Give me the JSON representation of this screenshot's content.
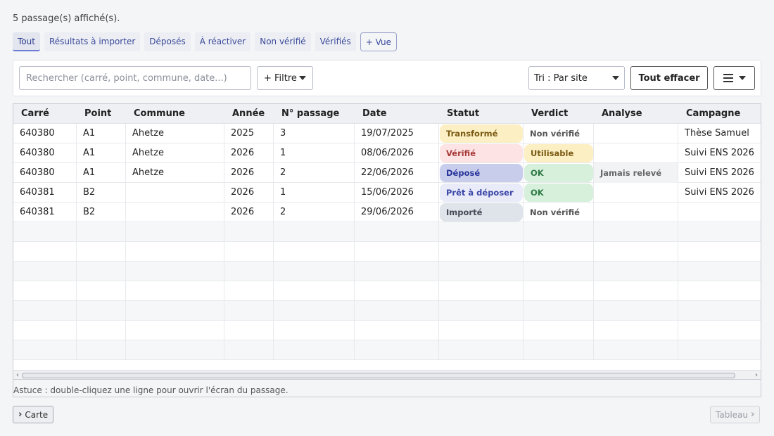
{
  "summary": "5 passage(s) affiché(s).",
  "tabs": [
    {
      "label": "Tout",
      "active": true
    },
    {
      "label": "Résultats à importer"
    },
    {
      "label": "Déposés"
    },
    {
      "label": "À réactiver"
    },
    {
      "label": "Non vérifié"
    },
    {
      "label": "Vérifiés"
    },
    {
      "label": "+ Vue"
    }
  ],
  "toolbar": {
    "search_placeholder": "Rechercher (carré, point, commune, date...)",
    "filter_label": "+ Filtre",
    "sort_label": "Tri : Par site",
    "clear_label": "Tout effacer",
    "menu_icon": "hamburger-icon"
  },
  "columns": [
    "Carré",
    "Point",
    "Commune",
    "Année",
    "N° passage",
    "Date",
    "Statut",
    "Verdict",
    "Analyse",
    "Campagne"
  ],
  "rows": [
    {
      "carre": "640380",
      "point": "A1",
      "commune": "Ahetze",
      "annee": "2025",
      "passage": "3",
      "date": "19/07/2025",
      "statut": "Transformé",
      "verdict": "Non vérifié",
      "analyse": "",
      "campagne": "Thèse Samuel"
    },
    {
      "carre": "640380",
      "point": "A1",
      "commune": "Ahetze",
      "annee": "2026",
      "passage": "1",
      "date": "08/06/2026",
      "statut": "Vérifié",
      "verdict": "Utilisable",
      "analyse": "",
      "campagne": "Suivi ENS 2026"
    },
    {
      "carre": "640380",
      "point": "A1",
      "commune": "Ahetze",
      "annee": "2026",
      "passage": "2",
      "date": "22/06/2026",
      "statut": "Déposé",
      "verdict": "OK",
      "analyse": "Jamais relevé",
      "campagne": "Suivi ENS 2026"
    },
    {
      "carre": "640381",
      "point": "B2",
      "commune": "",
      "annee": "2026",
      "passage": "1",
      "date": "15/06/2026",
      "statut": "Prêt à déposer",
      "verdict": "OK",
      "analyse": "",
      "campagne": "Suivi ENS 2026"
    },
    {
      "carre": "640381",
      "point": "B2",
      "commune": "",
      "annee": "2026",
      "passage": "2",
      "date": "29/06/2026",
      "statut": "Importé",
      "verdict": "Non vérifié",
      "analyse": "",
      "campagne": ""
    }
  ],
  "status_colors": {
    "Transformé": {
      "bg": "#fcefc4",
      "fg": "#7a5a12"
    },
    "Vérifié": {
      "bg": "#fde3e3",
      "fg": "#a83a3a"
    },
    "Déposé": {
      "bg": "#c9cdec",
      "fg": "#26339a"
    },
    "Prêt à déposer": {
      "bg": "#e9ebf8",
      "fg": "#3b47a8"
    },
    "Importé": {
      "bg": "#dfe3ea",
      "fg": "#444a55"
    }
  },
  "verdict_colors": {
    "Utilisable": {
      "bg": "#fcefc4",
      "fg": "#7a5a12"
    },
    "OK": {
      "bg": "#d6f0dc",
      "fg": "#2f7a45"
    }
  },
  "tip": "Astuce : double-cliquez une ligne pour ouvrir l'écran du passage.",
  "nav": {
    "prev_label": "Carte",
    "next_label": "Tableau"
  }
}
